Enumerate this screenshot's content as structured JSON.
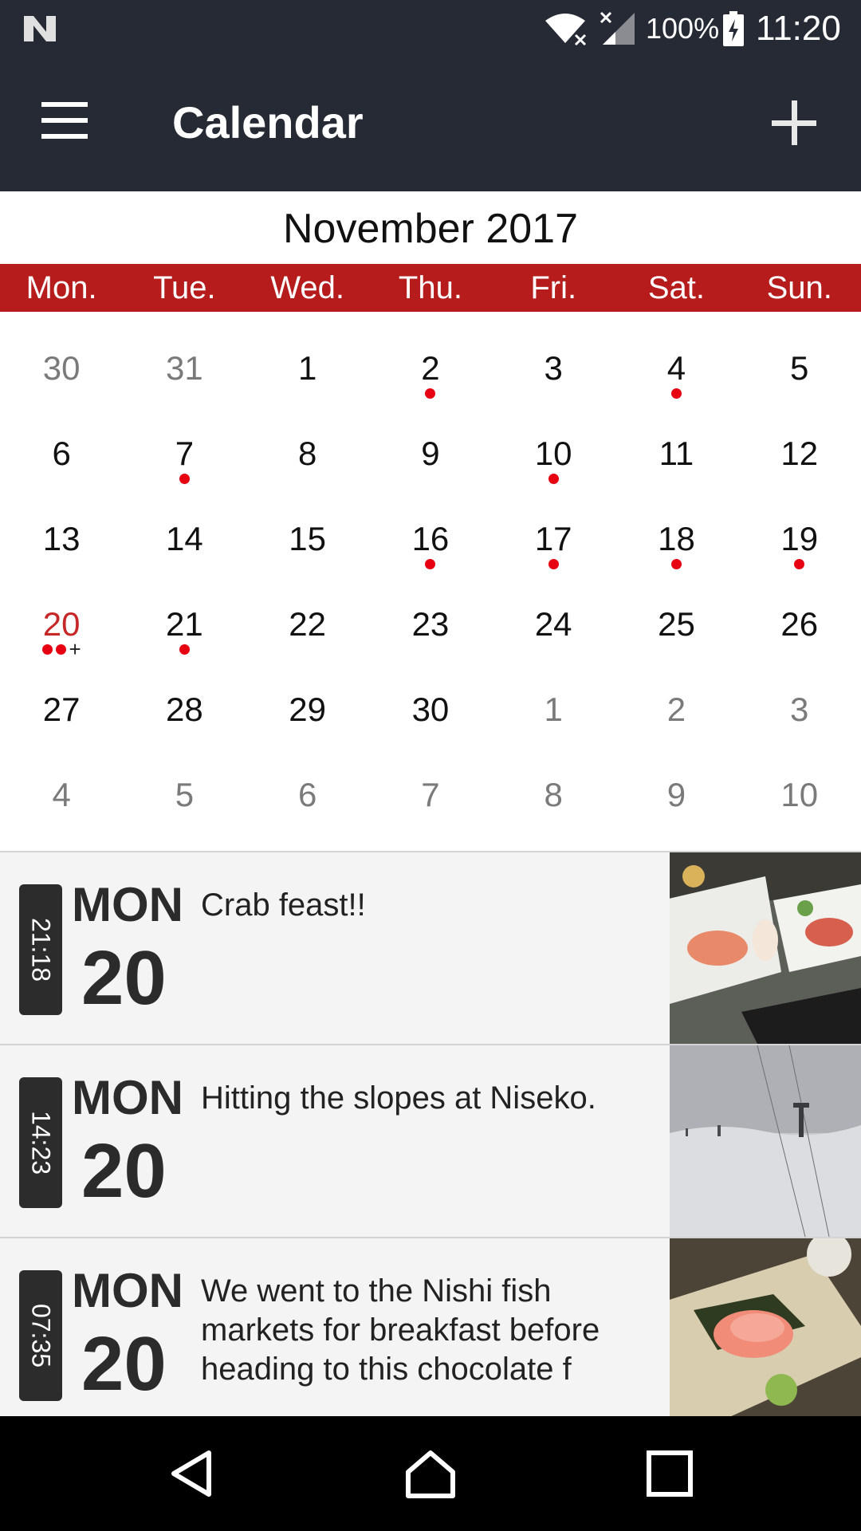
{
  "status_bar": {
    "battery": "100%",
    "time": "11:20"
  },
  "app_bar": {
    "title": "Calendar"
  },
  "calendar": {
    "month_label": "November 2017",
    "weekdays": [
      "Mon.",
      "Tue.",
      "Wed.",
      "Thu.",
      "Fri.",
      "Sat.",
      "Sun."
    ],
    "weeks": [
      [
        {
          "day": "30",
          "other": true,
          "dots": 0
        },
        {
          "day": "31",
          "other": true,
          "dots": 0
        },
        {
          "day": "1",
          "dots": 0
        },
        {
          "day": "2",
          "dots": 1
        },
        {
          "day": "3",
          "dots": 0
        },
        {
          "day": "4",
          "dots": 1
        },
        {
          "day": "5",
          "dots": 0
        }
      ],
      [
        {
          "day": "6",
          "dots": 0
        },
        {
          "day": "7",
          "dots": 1
        },
        {
          "day": "8",
          "dots": 0
        },
        {
          "day": "9",
          "dots": 0
        },
        {
          "day": "10",
          "dots": 1
        },
        {
          "day": "11",
          "dots": 0
        },
        {
          "day": "12",
          "dots": 0
        }
      ],
      [
        {
          "day": "13",
          "dots": 0
        },
        {
          "day": "14",
          "dots": 0
        },
        {
          "day": "15",
          "dots": 0
        },
        {
          "day": "16",
          "dots": 1
        },
        {
          "day": "17",
          "dots": 1
        },
        {
          "day": "18",
          "dots": 1
        },
        {
          "day": "19",
          "dots": 1
        }
      ],
      [
        {
          "day": "20",
          "today": true,
          "dots": 2,
          "more": "+"
        },
        {
          "day": "21",
          "dots": 1
        },
        {
          "day": "22",
          "dots": 0
        },
        {
          "day": "23",
          "dots": 0
        },
        {
          "day": "24",
          "dots": 0
        },
        {
          "day": "25",
          "dots": 0
        },
        {
          "day": "26",
          "dots": 0
        }
      ],
      [
        {
          "day": "27",
          "dots": 0
        },
        {
          "day": "28",
          "dots": 0
        },
        {
          "day": "29",
          "dots": 0
        },
        {
          "day": "30",
          "dots": 0
        },
        {
          "day": "1",
          "other": true,
          "dots": 0
        },
        {
          "day": "2",
          "other": true,
          "dots": 0
        },
        {
          "day": "3",
          "other": true,
          "dots": 0
        }
      ],
      [
        {
          "day": "4",
          "other": true,
          "dots": 0
        },
        {
          "day": "5",
          "other": true,
          "dots": 0
        },
        {
          "day": "6",
          "other": true,
          "dots": 0
        },
        {
          "day": "7",
          "other": true,
          "dots": 0
        },
        {
          "day": "8",
          "other": true,
          "dots": 0
        },
        {
          "day": "9",
          "other": true,
          "dots": 0
        },
        {
          "day": "10",
          "other": true,
          "dots": 0
        }
      ]
    ],
    "dot_color": "#e60012",
    "today_color": "#c62828",
    "weekday_bar_color": "#b71c1c"
  },
  "entries": [
    {
      "time": "21:18",
      "dow": "MON",
      "date": "20",
      "caption": "Crab feast!!",
      "thumb": "crab-photo"
    },
    {
      "time": "14:23",
      "dow": "MON",
      "date": "20",
      "caption": "Hitting the slopes at Niseko.",
      "thumb": "ski-slope-photo"
    },
    {
      "time": "07:35",
      "dow": "MON",
      "date": "20",
      "caption": "We went to the Nishi fish markets for breakfast before heading to this chocolate f",
      "thumb": "sashimi-photo"
    }
  ],
  "nav_bar": {
    "icons": [
      "back-icon",
      "home-icon",
      "recent-apps-icon"
    ]
  }
}
